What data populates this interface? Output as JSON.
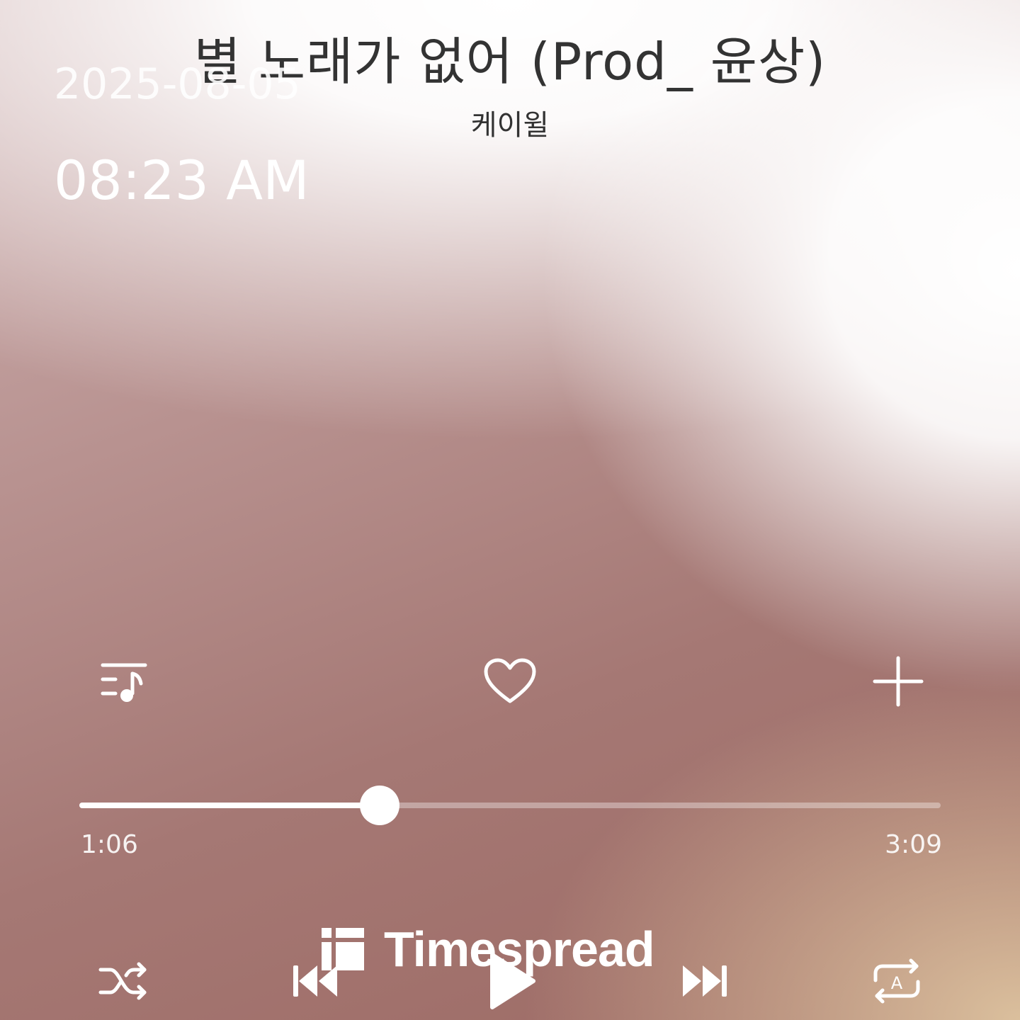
{
  "song": {
    "title": "별 노래가 없어 (Prod_ 윤상)",
    "artist": "케이윌"
  },
  "overlay": {
    "date": "2025-08-05",
    "time": "08:23 AM",
    "watermark": "Timespread"
  },
  "actions": {
    "lyrics_icon": "playlist-music-icon",
    "like_icon": "heart-outline-icon",
    "add_icon": "plus-icon"
  },
  "progress": {
    "current": "1:06",
    "total": "3:09",
    "fraction": 0.349
  },
  "controls": {
    "shuffle_icon": "shuffle-icon",
    "prev_icon": "skip-previous-icon",
    "play_icon": "play-icon",
    "next_icon": "skip-next-icon",
    "repeat_icon": "repeat-auto-icon"
  }
}
